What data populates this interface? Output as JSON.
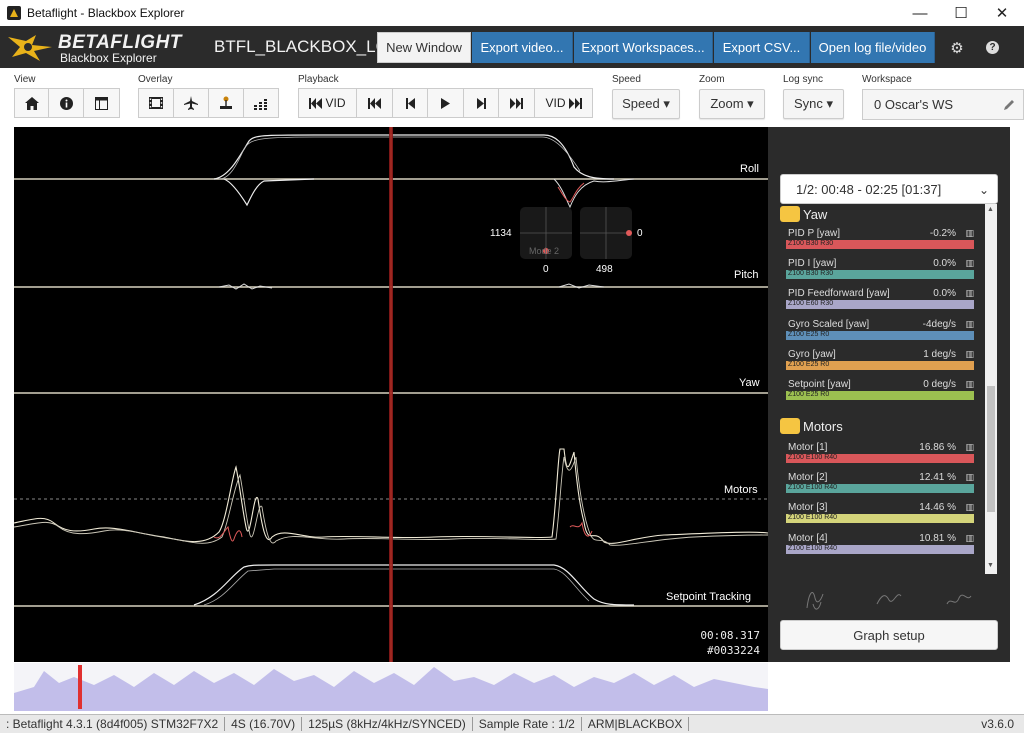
{
  "window": {
    "title": "Betaflight - Blackbox Explorer",
    "minimize": "—",
    "maximize": "☐",
    "close": "✕"
  },
  "header": {
    "logo_main": "BETAFLIGHT",
    "logo_sub": "Blackbox Explorer",
    "log_title": "BTFL_BLACKBOX_LOG",
    "buttons": {
      "new_window": "New Window",
      "export_video": "Export video...",
      "export_workspaces": "Export Workspaces...",
      "export_csv": "Export CSV...",
      "open_log": "Open log file/video"
    },
    "settings_icon": "gear-icon",
    "help_icon": "question-icon",
    "help_glyph": "?",
    "gear_glyph": "⚙"
  },
  "toolbar": {
    "labels": {
      "view": "View",
      "overlay": "Overlay",
      "playback": "Playback",
      "speed": "Speed",
      "zoom": "Zoom",
      "log_sync": "Log sync",
      "workspace": "Workspace"
    },
    "playback": {
      "vid_back": "VID",
      "vid_forward": "VID"
    },
    "speed": "Speed ▾",
    "zoom": "Zoom ▾",
    "sync": "Sync ▾",
    "workspace": "0 Oscar's WS"
  },
  "graph": {
    "labels": {
      "roll": "Roll",
      "pitch": "Pitch",
      "yaw": "Yaw",
      "motors": "Motors",
      "setpoint": "Setpoint Tracking"
    },
    "sticks": {
      "left_value": "1134",
      "left_bottom": "0",
      "mode": "Mode 2",
      "right_bottom": "498",
      "right_value": "0"
    },
    "time": "00:08.317",
    "frame": "#0033224",
    "colors": {
      "background": "#000000",
      "cursor": "#8b1a1a",
      "trace": "#f0ead6",
      "accent": "#e05a5a"
    }
  },
  "panel": {
    "range": "1/2: 00:48 - 02:25 [01:37]",
    "range_caret": "⌄",
    "groups": [
      {
        "name": "Yaw",
        "fields": [
          {
            "name": "PID P [yaw]",
            "value": "-0.2%",
            "tag": "Z100 B30 R30",
            "color": "#d9575a"
          },
          {
            "name": "PID I [yaw]",
            "value": "0.0%",
            "tag": "Z100 B30 R30",
            "color": "#5aa59c"
          },
          {
            "name": "PID Feedforward [yaw]",
            "value": "0.0%",
            "tag": "Z100 E60 R30",
            "color": "#a9a6c8"
          },
          {
            "name": "Gyro Scaled [yaw]",
            "value": "-4deg/s",
            "tag": "Z100 E25 R0",
            "color": "#5e8fb8"
          },
          {
            "name": "Gyro [yaw]",
            "value": "1 deg/s",
            "tag": "Z100 E25 R0",
            "color": "#e0a050"
          },
          {
            "name": "Setpoint [yaw]",
            "value": "0 deg/s",
            "tag": "Z100 E25 R0",
            "color": "#9bbf50"
          }
        ]
      },
      {
        "name": "Motors",
        "fields": [
          {
            "name": "Motor [1]",
            "value": "16.86 %",
            "tag": "Z100 E100 R40",
            "color": "#d9575a"
          },
          {
            "name": "Motor [2]",
            "value": "12.41 %",
            "tag": "Z100 E100 R40",
            "color": "#5aa59c"
          },
          {
            "name": "Motor [3]",
            "value": "14.46 %",
            "tag": "Z100 E100 R40",
            "color": "#d4d47a"
          },
          {
            "name": "Motor [4]",
            "value": "10.81 %",
            "tag": "Z100 E100 R40",
            "color": "#a9a6c8"
          }
        ]
      }
    ],
    "graph_setup": "Graph setup"
  },
  "status": {
    "segments": [
      ": Betaflight 4.3.1 (8d4f005) STM32F7X2",
      "4S (16.70V)",
      "125µS (8kHz/4kHz/SYNCED)",
      "Sample Rate : 1/2",
      "ARM|BLACKBOX"
    ],
    "version": "v3.6.0"
  }
}
